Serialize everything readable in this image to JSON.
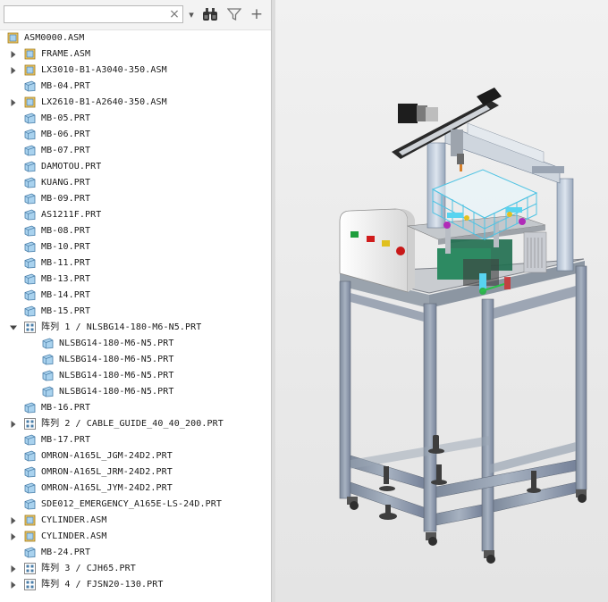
{
  "toolbar": {
    "search_value": "",
    "clear_label": "×",
    "dropdown_label": "▾",
    "find_label": "find",
    "filter_label": "filter",
    "add_label": "+"
  },
  "tree": {
    "root": "ASM0000.ASM",
    "items": [
      {
        "label": "FRAME.ASM",
        "type": "asm",
        "expandable": true,
        "level": 1
      },
      {
        "label": "LX3010-B1-A3040-350.ASM",
        "type": "asm",
        "expandable": true,
        "level": 1
      },
      {
        "label": "MB-04.PRT",
        "type": "prt",
        "expandable": false,
        "level": 1
      },
      {
        "label": "LX2610-B1-A2640-350.ASM",
        "type": "asm",
        "expandable": true,
        "level": 1
      },
      {
        "label": "MB-05.PRT",
        "type": "prt",
        "expandable": false,
        "level": 1
      },
      {
        "label": "MB-06.PRT",
        "type": "prt",
        "expandable": false,
        "level": 1
      },
      {
        "label": "MB-07.PRT",
        "type": "prt",
        "expandable": false,
        "level": 1
      },
      {
        "label": "DAMOTOU.PRT",
        "type": "prt",
        "expandable": false,
        "level": 1
      },
      {
        "label": "KUANG.PRT",
        "type": "prt",
        "expandable": false,
        "level": 1
      },
      {
        "label": "MB-09.PRT",
        "type": "prt",
        "expandable": false,
        "level": 1
      },
      {
        "label": "AS1211F.PRT",
        "type": "prt",
        "expandable": false,
        "level": 1
      },
      {
        "label": "MB-08.PRT",
        "type": "prt",
        "expandable": false,
        "level": 1
      },
      {
        "label": "MB-10.PRT",
        "type": "prt",
        "expandable": false,
        "level": 1
      },
      {
        "label": "MB-11.PRT",
        "type": "prt",
        "expandable": false,
        "level": 1
      },
      {
        "label": "MB-13.PRT",
        "type": "prt",
        "expandable": false,
        "level": 1
      },
      {
        "label": "MB-14.PRT",
        "type": "prt",
        "expandable": false,
        "level": 1
      },
      {
        "label": "MB-15.PRT",
        "type": "prt",
        "expandable": false,
        "level": 1
      },
      {
        "label": "阵列 1 / NLSBG14-180-M6-N5.PRT",
        "type": "pattern",
        "expandable": true,
        "expanded": true,
        "level": 1
      },
      {
        "label": "NLSBG14-180-M6-N5.PRT",
        "type": "prt",
        "expandable": false,
        "level": 2
      },
      {
        "label": "NLSBG14-180-M6-N5.PRT",
        "type": "prt",
        "expandable": false,
        "level": 2
      },
      {
        "label": "NLSBG14-180-M6-N5.PRT",
        "type": "prt",
        "expandable": false,
        "level": 2
      },
      {
        "label": "NLSBG14-180-M6-N5.PRT",
        "type": "prt",
        "expandable": false,
        "level": 2
      },
      {
        "label": "MB-16.PRT",
        "type": "prt",
        "expandable": false,
        "level": 1
      },
      {
        "label": "阵列 2 / CABLE_GUIDE_40_40_200.PRT",
        "type": "pattern",
        "expandable": true,
        "level": 1
      },
      {
        "label": "MB-17.PRT",
        "type": "prt",
        "expandable": false,
        "level": 1
      },
      {
        "label": "OMRON-A165L_JGM-24D2.PRT",
        "type": "prt",
        "expandable": false,
        "level": 1
      },
      {
        "label": "OMRON-A165L_JRM-24D2.PRT",
        "type": "prt",
        "expandable": false,
        "level": 1
      },
      {
        "label": "OMRON-A165L_JYM-24D2.PRT",
        "type": "prt",
        "expandable": false,
        "level": 1
      },
      {
        "label": "SDE012_EMERGENCY_A165E-LS-24D.PRT",
        "type": "prt",
        "expandable": false,
        "level": 1
      },
      {
        "label": "CYLINDER.ASM",
        "type": "asm",
        "expandable": true,
        "level": 1
      },
      {
        "label": "CYLINDER.ASM",
        "type": "asm",
        "expandable": true,
        "level": 1
      },
      {
        "label": "MB-24.PRT",
        "type": "prt",
        "expandable": false,
        "level": 1
      },
      {
        "label": "阵列 3 / CJH65.PRT",
        "type": "pattern",
        "expandable": true,
        "level": 1
      },
      {
        "label": "阵列 4 / FJSN20-130.PRT",
        "type": "pattern",
        "expandable": true,
        "level": 1
      }
    ]
  },
  "colors": {
    "part_icon": "#a9d2ee",
    "asm_icon": "#f2c860",
    "pattern_icon": "#ffffff",
    "frame": "#8e9aac",
    "viewport_bg": "#ececec",
    "panel_white": "#f6f6f6",
    "plate": "#bfc3c8",
    "blue_slide": "#6ad0e8"
  }
}
